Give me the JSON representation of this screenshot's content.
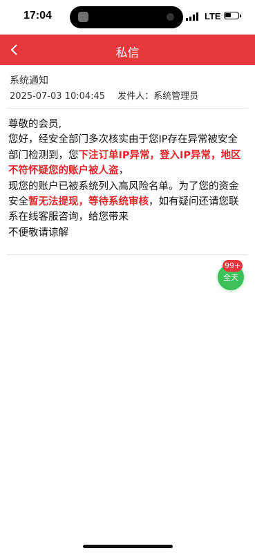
{
  "status_bar": {
    "time": "17:04",
    "network": "LTE",
    "battery_level": 0.45
  },
  "header": {
    "title": "私信",
    "back_icon": "chevron-left-icon",
    "background": "#e5383d"
  },
  "message": {
    "title": "系统通知",
    "datetime": "2025-07-03 10:04:45",
    "sender_label": "发件人：系统管理员",
    "body": {
      "greeting": "尊敬的会员,",
      "p1a": "您好，经安全部门多次核实由于您IP存在异常被安全部门检测到，您",
      "p1b_red": "下注订单IP异常，登入IP异常，地区不符怀疑您的账户被人盗",
      "p1c": "，",
      "p2a": "现您的账户已被系统列入高风险名单。为了您的资金安全",
      "p2b_red": "暂无法提现，等待系统审核",
      "p2c": "，如有疑问还请您联系在线客服咨询，给您带来",
      "p3": "不便敬请谅解"
    },
    "highlight_color": "#e2262b"
  },
  "float_button": {
    "label": "全天",
    "badge": "99+",
    "color": "#3cc05a"
  }
}
